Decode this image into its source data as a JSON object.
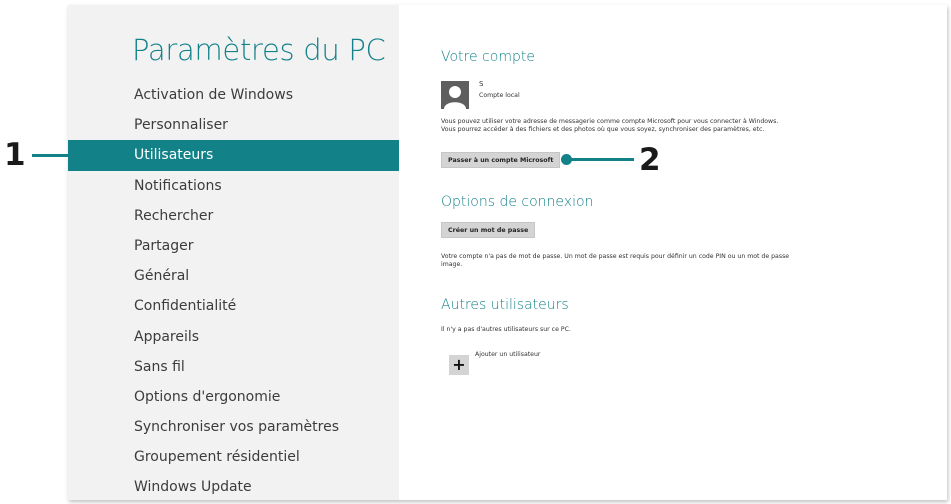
{
  "app_title": "Paramètres du PC",
  "nav": {
    "items": [
      "Activation de Windows",
      "Personnaliser",
      "Utilisateurs",
      "Notifications",
      "Rechercher",
      "Partager",
      "Général",
      "Confidentialité",
      "Appareils",
      "Sans fil",
      "Options d'ergonomie",
      "Synchroniser vos paramètres",
      "Groupement résidentiel",
      "Windows Update"
    ],
    "selected": "Utilisateurs"
  },
  "account": {
    "title": "Votre compte",
    "user_name": "S",
    "account_type": "Compte local",
    "description": "Vous pouvez utiliser votre adresse de messagerie comme compte Microsoft pour vous connecter à Windows. Vous pourrez accéder à des fichiers et des photos où que vous soyez, synchroniser des paramètres, etc.",
    "switch_button": "Passer à un compte Microsoft"
  },
  "signin": {
    "title": "Options de connexion",
    "create_password_button": "Créer un mot de passe",
    "description": "Votre compte n'a pas de mot de passe. Un mot de passe est requis pour définir un code PIN ou un mot de passe image."
  },
  "other_users": {
    "title": "Autres utilisateurs",
    "none_text": "Il n'y a pas d'autres utilisateurs sur ce PC.",
    "add_user_label": "Ajouter un utilisateur",
    "add_icon_glyph": "+"
  },
  "callouts": {
    "one": "1",
    "two": "2"
  },
  "colors": {
    "accent": "#138188",
    "title": "#15828a",
    "left_pane_bg": "#f2f2f2"
  }
}
